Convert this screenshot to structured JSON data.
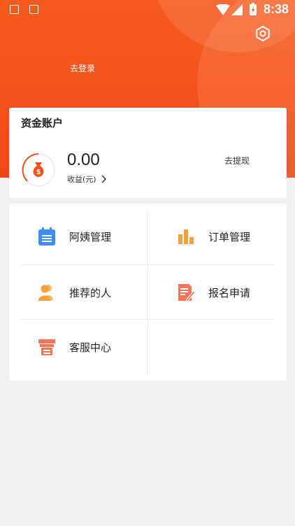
{
  "status_bar": {
    "time": "8:38"
  },
  "header": {
    "login_label": "去登录"
  },
  "account": {
    "title": "资金账户",
    "amount": "0.00",
    "income_label": "收益(元)",
    "withdraw_label": "去提现"
  },
  "menu": {
    "items": [
      {
        "label": "阿姨管理",
        "icon": "clipboard-icon",
        "color": "#3d8ef0"
      },
      {
        "label": "订单管理",
        "icon": "bar-chart-icon",
        "color": "#f3a23a"
      },
      {
        "label": "推荐的人",
        "icon": "users-icon",
        "color": "#f3a23a"
      },
      {
        "label": "报名申请",
        "icon": "document-edit-icon",
        "color": "#f3765a"
      },
      {
        "label": "客服中心",
        "icon": "printer-icon",
        "color": "#f3765a"
      }
    ]
  },
  "colors": {
    "accent": "#f25219"
  }
}
